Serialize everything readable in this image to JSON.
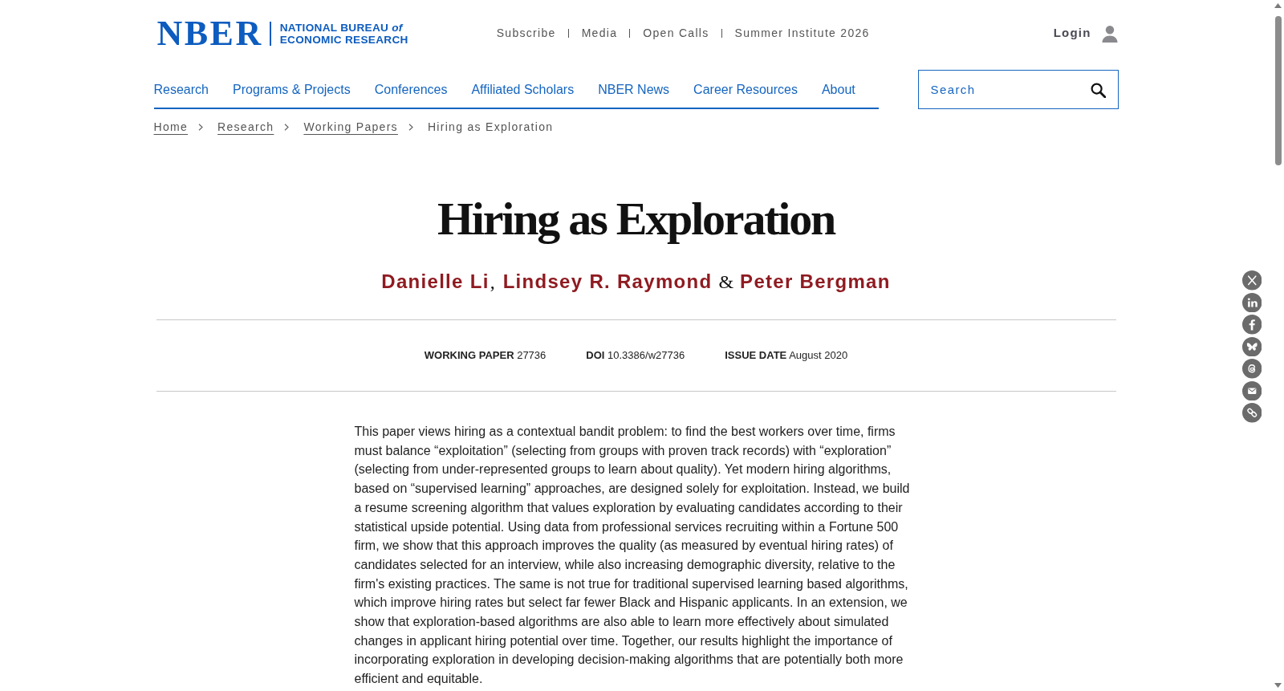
{
  "header": {
    "logo": {
      "acronym": "NBER",
      "line_1": "NATIONAL BUREAU *of*",
      "line_2": "ECONOMIC RESEARCH"
    },
    "utility_links": [
      "Subscribe",
      "Media",
      "Open Calls",
      "Summer Institute 2026"
    ],
    "login": "Login"
  },
  "nav": [
    "Research",
    "Programs & Projects",
    "Conferences",
    "Affiliated Scholars",
    "NBER News",
    "Career Resources",
    "About"
  ],
  "search": {
    "placeholder": "Search"
  },
  "breadcrumb": [
    {
      "label": "Home",
      "kind": "link"
    },
    {
      "label": "Research",
      "kind": "link"
    },
    {
      "label": "Working Papers",
      "kind": "link"
    },
    {
      "label": "Hiring as Exploration",
      "kind": "current"
    }
  ],
  "paper": {
    "title": "Hiring as Exploration",
    "authors": [
      {
        "name": "Danielle Li",
        "separator_after": ","
      },
      {
        "name": "Lindsey R. Raymond",
        "separator_after": "&"
      },
      {
        "name": "Peter Bergman"
      }
    ],
    "meta": [
      {
        "label": "WORKING PAPER",
        "value": "27736"
      },
      {
        "label": "DOI",
        "value": "10.3386/w27736"
      },
      {
        "label": "ISSUE DATE",
        "value": "August 2020"
      }
    ],
    "abstract": "This paper views hiring as a contextual bandit problem: to find the best workers over time, firms must balance “exploitation” (selecting from groups with proven track records) with “exploration” (selecting from under-represented groups to learn about quality). Yet modern hiring algorithms, based on “supervised learning” approaches, are designed solely for exploitation. Instead, we build a resume screening algorithm that values exploration by evaluating candidates according to their statistical upside potential. Using data from professional services recruiting within a Fortune 500 firm, we show that this approach improves the quality (as measured by eventual hiring rates) of candidates selected for an interview, while also increasing demographic diversity, relative to the firm's existing practices. The same is not true for traditional supervised learning based algorithms, which improve hiring rates but select far fewer Black and Hispanic applicants. In an extension, we show that exploration-based algorithms are also able to learn more effectively about simulated changes in applicant hiring potential over time. Together, our results highlight the importance of incorporating exploration in developing decision-making algorithms that are potentially both more efficient and equitable."
  }
}
